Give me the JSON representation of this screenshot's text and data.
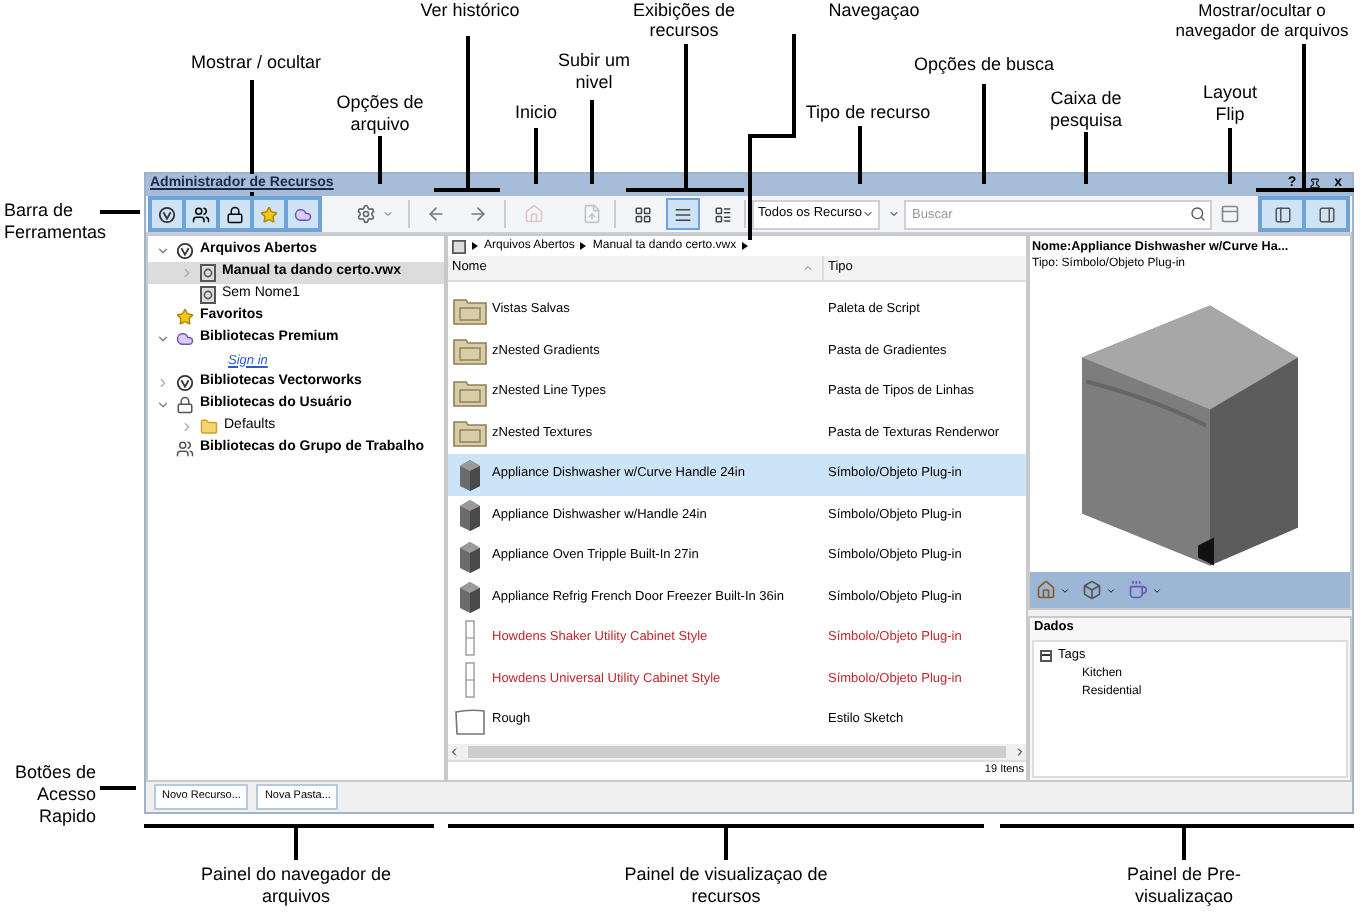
{
  "annotations": [
    "Ver histórico",
    "Exibições de recursos",
    "Navegaçao",
    "Mostrar/ocultar o navegador de arquivos",
    "Mostrar / ocultar",
    "Subir um nivel",
    "Opções de busca",
    "Opções de arquivo",
    "Inicio",
    "Tipo de recurso",
    "Caixa de pesquisa",
    "Layout Flip",
    "Barra de Ferramentas",
    "Botões de Acesso Rapido",
    "Painel do navegador de arquivos",
    "Painel de visualizaçao de recursos",
    "Painel de Pre-visualizaçao"
  ],
  "window": {
    "title": "Administrador de Recursos",
    "help": "?",
    "close": "x"
  },
  "toolbar": {
    "show_hide": [
      {
        "selected": true
      },
      {
        "selected": true
      },
      {
        "selected": true
      },
      {
        "selected": true
      },
      {
        "selected": true
      }
    ],
    "history": [
      {
        "disabled": false
      },
      {
        "disabled": false
      }
    ],
    "home": {
      "disabled": true
    },
    "up": {
      "disabled": true
    },
    "views": [
      {
        "selected": false
      },
      {
        "selected": true
      },
      {
        "selected": false
      }
    ],
    "resource_type": "Todos os Recurso",
    "search": {
      "placeholder": "Buscar"
    },
    "file_browser_toggles": [
      {
        "selected": true
      },
      {
        "selected": true
      }
    ]
  },
  "tree": [
    {
      "label": "Arquivos Abertos",
      "kind": "open-files",
      "expanded": true,
      "selected": false,
      "children": [
        {
          "label": "Manual ta dando certo.vwx",
          "kind": "file",
          "expanded": false,
          "selected": true
        },
        {
          "label": "Sem Nome1",
          "kind": "file",
          "selected": false
        }
      ]
    },
    {
      "label": "Favoritos",
      "kind": "favorites",
      "selected": false
    },
    {
      "label": "Bibliotecas Premium",
      "kind": "premium",
      "expanded": true,
      "selected": false,
      "children": [
        {
          "label": "Sign in",
          "kind": "link",
          "selected": false
        }
      ]
    },
    {
      "label": "Bibliotecas Vectorworks",
      "kind": "library",
      "expanded": false,
      "selected": false
    },
    {
      "label": "Bibliotecas do Usuário",
      "kind": "user",
      "expanded": true,
      "selected": false,
      "children": [
        {
          "label": "Defaults",
          "kind": "folder",
          "expanded": false,
          "selected": false
        }
      ]
    },
    {
      "label": "Bibliotecas do Grupo de Trabalho",
      "kind": "workgroup",
      "selected": false
    }
  ],
  "breadcrumb": [
    "Arquivos Abertos",
    "Manual ta dando certo.vwx"
  ],
  "columns": [
    "Nome",
    "Tipo"
  ],
  "rows": [
    {
      "name": "Vistas Salvas",
      "type": "Paleta de Script",
      "kind": "folder",
      "color": "#000000",
      "selected": false
    },
    {
      "name": "zNested Gradients",
      "type": "Pasta de Gradientes",
      "kind": "folder",
      "color": "#000000",
      "selected": false
    },
    {
      "name": "zNested Line Types",
      "type": "Pasta de Tipos de Linhas",
      "kind": "folder",
      "color": "#000000",
      "selected": false
    },
    {
      "name": "zNested Textures",
      "type": "Pasta de Texturas Renderwor",
      "kind": "folder",
      "color": "#000000",
      "selected": false
    },
    {
      "name": "Appliance Dishwasher w/Curve Handle 24in",
      "type": "Símbolo/Objeto Plug-in",
      "kind": "appliance",
      "color": "#000000",
      "selected": true
    },
    {
      "name": "Appliance Dishwasher w/Handle 24in",
      "type": "Símbolo/Objeto Plug-in",
      "kind": "appliance",
      "color": "#000000",
      "selected": false
    },
    {
      "name": "Appliance Oven Tripple Built-In 27in",
      "type": "Símbolo/Objeto Plug-in",
      "kind": "appliance",
      "color": "#000000",
      "selected": false
    },
    {
      "name": "Appliance Refrig French Door Freezer Built-In 36in",
      "type": "Símbolo/Objeto Plug-in",
      "kind": "appliance",
      "color": "#000000",
      "selected": false
    },
    {
      "name": "Howdens Shaker Utility Cabinet Style",
      "type": "Símbolo/Objeto Plug-in",
      "kind": "cabinet",
      "color": "#c0282d",
      "selected": false
    },
    {
      "name": "Howdens Universal Utility Cabinet Style",
      "type": "Símbolo/Objeto Plug-in",
      "kind": "cabinet",
      "color": "#c0282d",
      "selected": false
    },
    {
      "name": "Rough",
      "type": "Estilo Sketch",
      "kind": "sketch",
      "color": "#000000",
      "selected": false
    }
  ],
  "status": "19 Itens",
  "preview": {
    "name": "Nome:Appliance Dishwasher w/Curve Ha...",
    "type": "Tipo: Símbolo/Objeto Plug-in"
  },
  "data_panel": {
    "title": "Dados",
    "tree": [
      {
        "label": "Tags",
        "expanded": true,
        "children": [
          {
            "label": "Kitchen"
          },
          {
            "label": "Residential"
          }
        ]
      }
    ]
  },
  "buttons": [
    "Novo Recurso...",
    "Nova Pasta..."
  ]
}
